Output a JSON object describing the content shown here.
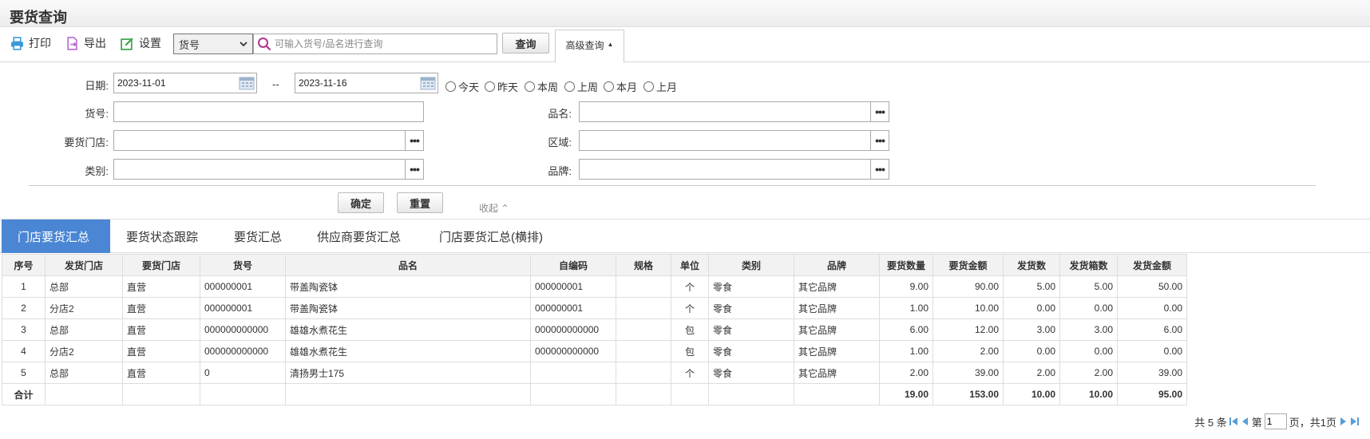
{
  "page": {
    "title": "要货查询"
  },
  "toolbar": {
    "print_label": "打印",
    "export_label": "导出",
    "settings_label": "设置",
    "field_select": "货号",
    "search_placeholder": "可输入货号/品名进行查询",
    "query_label": "查询",
    "advanced_label": "高级查询"
  },
  "form": {
    "date_label": "日期:",
    "date_from": "2023-11-01",
    "date_sep": "--",
    "date_to": "2023-11-16",
    "quick_dates": [
      "今天",
      "昨天",
      "本周",
      "上周",
      "本月",
      "上月"
    ],
    "code_label": "货号:",
    "name_label": "品名:",
    "store_label": "要货门店:",
    "region_label": "区域:",
    "category_label": "类别:",
    "brand_label": "品牌:",
    "ok_label": "确定",
    "reset_label": "重置",
    "collapse_label": "收起"
  },
  "tabs": [
    "门店要货汇总",
    "要货状态跟踪",
    "要货汇总",
    "供应商要货汇总",
    "门店要货汇总(横排)"
  ],
  "table": {
    "headers": [
      "序号",
      "发货门店",
      "要货门店",
      "货号",
      "品名",
      "自编码",
      "规格",
      "单位",
      "类别",
      "品牌",
      "要货数量",
      "要货金额",
      "发货数",
      "发货箱数",
      "发货金额"
    ],
    "rows": [
      [
        "1",
        "总部",
        "直营",
        "000000001",
        "带盖陶瓷钵",
        "000000001",
        "",
        "个",
        "零食",
        "其它品牌",
        "9.00",
        "90.00",
        "5.00",
        "5.00",
        "50.00"
      ],
      [
        "2",
        "分店2",
        "直营",
        "000000001",
        "带盖陶瓷钵",
        "000000001",
        "",
        "个",
        "零食",
        "其它品牌",
        "1.00",
        "10.00",
        "0.00",
        "0.00",
        "0.00"
      ],
      [
        "3",
        "总部",
        "直营",
        "000000000000",
        "雄雄水煮花生",
        "000000000000",
        "",
        "包",
        "零食",
        "其它品牌",
        "6.00",
        "12.00",
        "3.00",
        "3.00",
        "6.00"
      ],
      [
        "4",
        "分店2",
        "直营",
        "000000000000",
        "雄雄水煮花生",
        "000000000000",
        "",
        "包",
        "零食",
        "其它品牌",
        "1.00",
        "2.00",
        "0.00",
        "0.00",
        "0.00"
      ],
      [
        "5",
        "总部",
        "直营",
        "0",
        "清扬男士175",
        "",
        "",
        "个",
        "零食",
        "其它品牌",
        "2.00",
        "39.00",
        "2.00",
        "2.00",
        "39.00"
      ]
    ],
    "total": [
      "合计",
      "",
      "",
      "",
      "",
      "",
      "",
      "",
      "",
      "",
      "19.00",
      "153.00",
      "10.00",
      "10.00",
      "95.00"
    ]
  },
  "pager": {
    "total_text": "共 5 条",
    "page_prefix": "第",
    "current_page": "1",
    "page_suffix": "页，共1页"
  },
  "colors": {
    "active_tab": "#4a86d4",
    "print_icon": "#3a9ad9",
    "export_icon": "#b36ad1",
    "settings_icon": "#3aa34a",
    "search_icon": "#b0368a"
  }
}
